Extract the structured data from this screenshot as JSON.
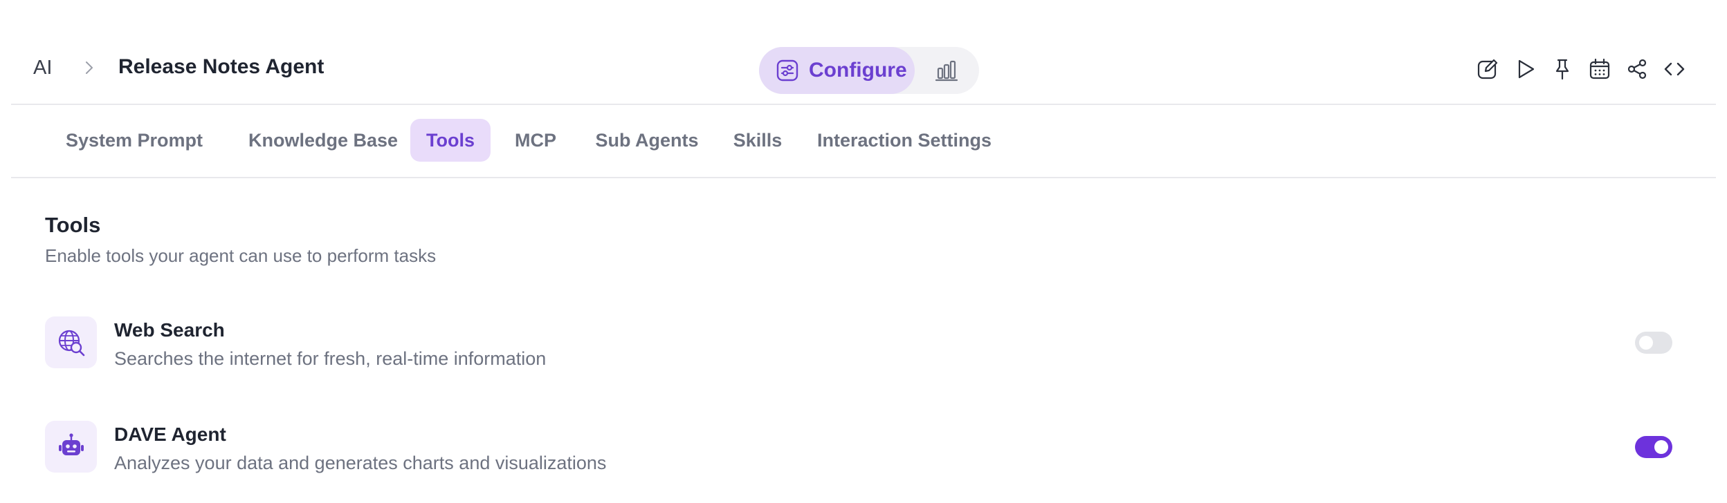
{
  "breadcrumb": {
    "root": "AI",
    "separator_icon": "chevron-right-icon",
    "title": "Release Notes Agent"
  },
  "mode_switch": {
    "configure_label": "Configure",
    "configure_icon": "sliders-icon",
    "analytics_icon": "bar-chart-icon",
    "active": "configure"
  },
  "toolbar": {
    "icons": [
      "edit-icon",
      "play-icon",
      "pin-icon",
      "calendar-icon",
      "share-icon",
      "code-icon"
    ]
  },
  "tabs": [
    {
      "label": "System Prompt",
      "active": false
    },
    {
      "label": "Knowledge Base",
      "active": false
    },
    {
      "label": "Tools",
      "active": true
    },
    {
      "label": "MCP",
      "active": false
    },
    {
      "label": "Sub Agents",
      "active": false
    },
    {
      "label": "Skills",
      "active": false
    },
    {
      "label": "Interaction Settings",
      "active": false
    }
  ],
  "section": {
    "title": "Tools",
    "subtitle": "Enable tools your agent can use to perform tasks"
  },
  "tools": [
    {
      "name": "Web Search",
      "description": "Searches the internet for fresh, real-time information",
      "icon": "globe-search-icon",
      "enabled": false
    },
    {
      "name": "DAVE Agent",
      "description": "Analyzes your data and generates charts and visualizations",
      "icon": "robot-icon",
      "enabled": true
    }
  ],
  "colors": {
    "accent": "#6d32dc",
    "accent_text": "#6b3fd0",
    "accent_soft": "#e9dcfa",
    "toggle_off": "#e3e4e8"
  }
}
